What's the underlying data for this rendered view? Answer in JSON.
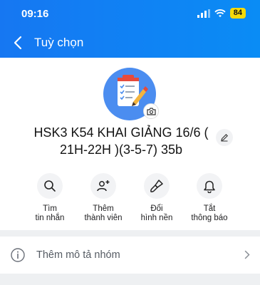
{
  "status": {
    "time": "09:16",
    "battery": "84"
  },
  "nav": {
    "title": "Tuỳ chọn"
  },
  "group": {
    "name": "HSK3 K54 KHAI GIẢNG 16/6 ( 21H-22H )(3-5-7) 35b"
  },
  "actions": [
    {
      "label": "Tìm\ntin nhắn",
      "icon": "search-icon"
    },
    {
      "label": "Thêm\nthành viên",
      "icon": "add-member-icon"
    },
    {
      "label": "Đổi\nhình nền",
      "icon": "paint-brush-icon"
    },
    {
      "label": "Tắt\nthông báo",
      "icon": "bell-icon"
    }
  ],
  "description_row": {
    "label": "Thêm mô tả nhóm",
    "icon": "info-icon"
  },
  "colors": {
    "header": "#1677f2",
    "battery": "#f5d90a"
  }
}
